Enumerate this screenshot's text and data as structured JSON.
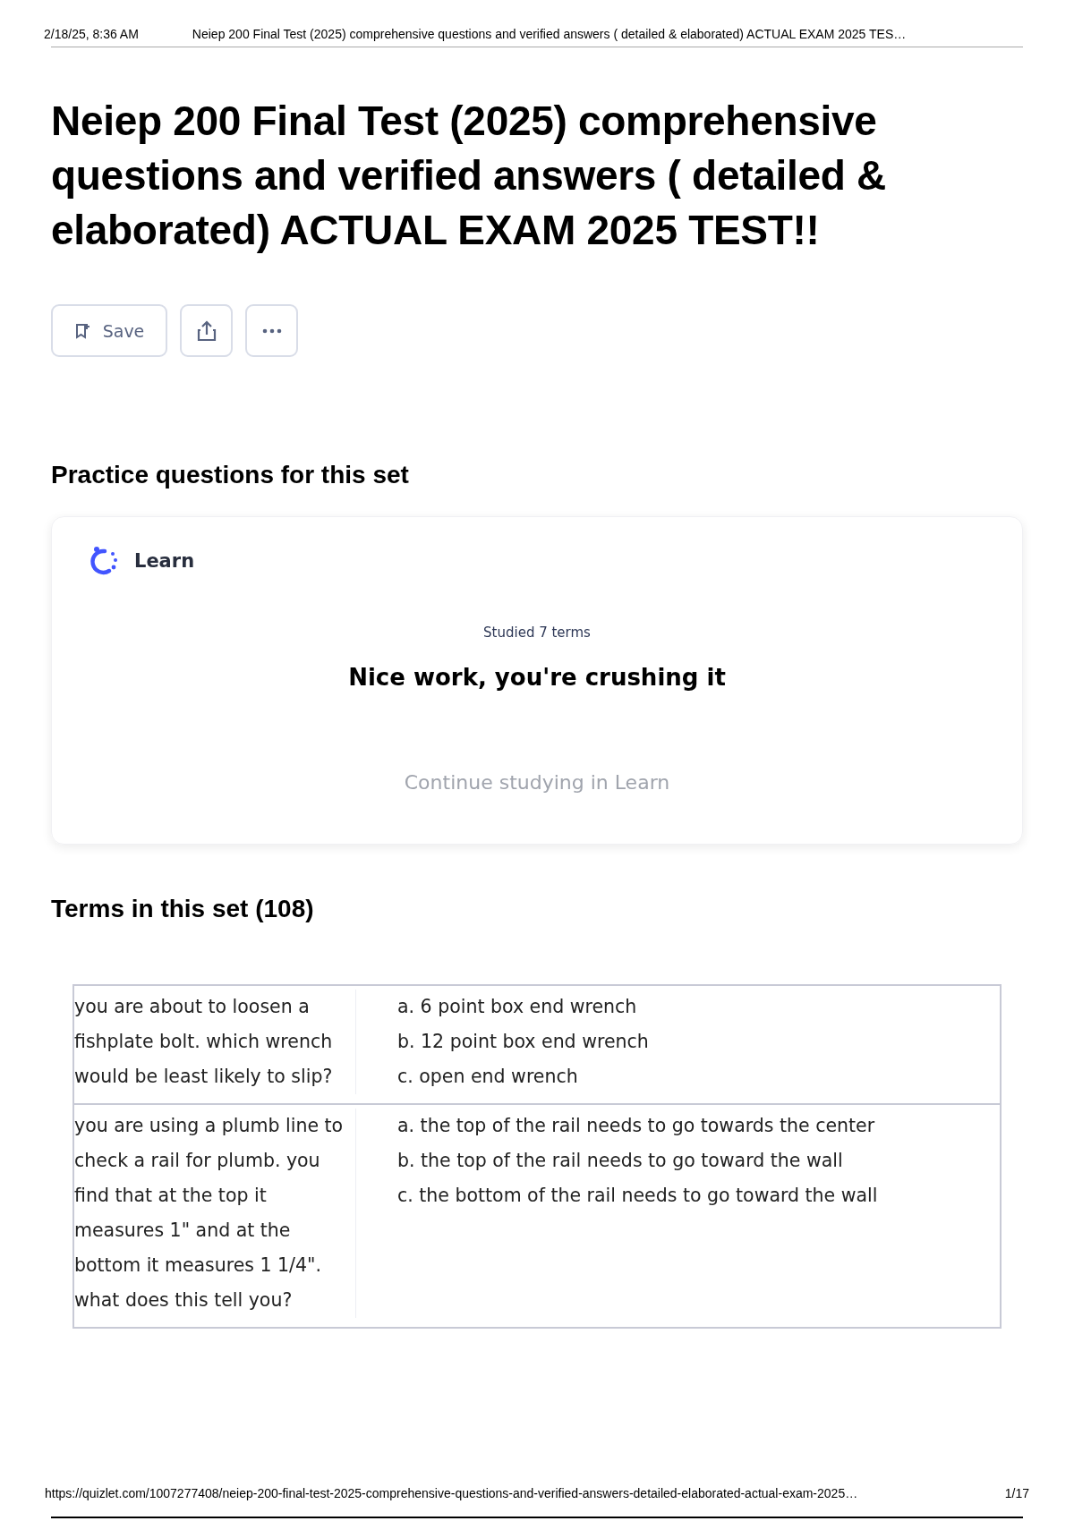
{
  "print_header": {
    "date": "2/18/25, 8:36 AM",
    "title": "Neiep 200 Final Test (2025) comprehensive questions and verified answers ( detailed & elaborated) ACTUAL EXAM 2025 TES…"
  },
  "set_title": "Neiep 200 Final Test (2025) comprehensive questions and verified answers ( detailed & elaborated) ACTUAL EXAM 2025 TEST!!",
  "actions": [
    {
      "kind": "save",
      "label": "Save"
    },
    {
      "kind": "share"
    },
    {
      "kind": "more"
    }
  ],
  "practice": {
    "heading": "Practice questions for this set",
    "mode": "Learn",
    "progress": "Studied 7 terms",
    "message": "Nice work, you're crushing it",
    "link": "Continue studying in Learn"
  },
  "terms": {
    "heading": "Terms in this set (108)",
    "rows": [
      {
        "term": "you are about to loosen a fishplate bolt. which wrench would be least likely to slip?",
        "definition": [
          "a. 6 point box end wrench",
          "b. 12 point box end wrench",
          "c. open end wrench"
        ]
      },
      {
        "term": "you are using a plumb line to check a rail for plumb. you find that at the top it measures 1\" and at the bottom it measures 1 1/4\". what does this tell you?",
        "definition": [
          "a. the top of the rail needs to go towards the center",
          "b. the top of the rail needs to go toward the wall",
          "c. the bottom of the rail needs to go toward the wall"
        ]
      }
    ]
  },
  "print_footer": {
    "url": "https://quizlet.com/1007277408/neiep-200-final-test-2025-comprehensive-questions-and-verified-answers-detailed-elaborated-actual-exam-2025…",
    "page": "1/17"
  }
}
